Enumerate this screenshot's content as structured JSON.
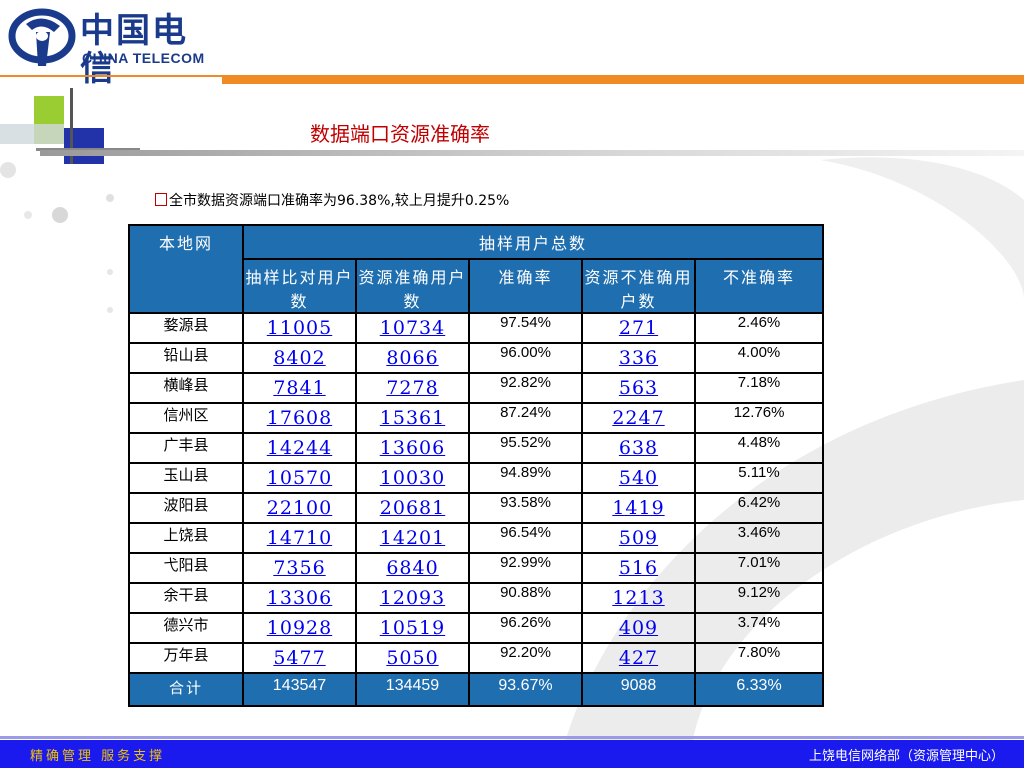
{
  "header": {
    "logo_cn": "中国电信",
    "logo_en": "CHINA TELECOM"
  },
  "title": "数据端口资源准确率",
  "bullet": "全市数据资源端口准确率为96.38%,较上月提升0.25%",
  "table": {
    "col_region": "本地网",
    "col_group": "抽样用户总数",
    "sub_headers": [
      "抽样比对用户数",
      "资源准确用户数",
      "准确率",
      "资源不准确用户数",
      "不准确率"
    ],
    "rows": [
      {
        "name": "婺源县",
        "sample": "11005",
        "accurate": "10734",
        "rate": "97.54%",
        "inaccurate": "271",
        "inrate": "2.46%"
      },
      {
        "name": "铅山县",
        "sample": "8402",
        "accurate": "8066",
        "rate": "96.00%",
        "inaccurate": "336",
        "inrate": "4.00%"
      },
      {
        "name": "横峰县",
        "sample": "7841",
        "accurate": "7278",
        "rate": "92.82%",
        "inaccurate": "563",
        "inrate": "7.18%"
      },
      {
        "name": "信州区",
        "sample": "17608",
        "accurate": "15361",
        "rate": "87.24%",
        "inaccurate": "2247",
        "inrate": "12.76%"
      },
      {
        "name": "广丰县",
        "sample": "14244",
        "accurate": "13606",
        "rate": "95.52%",
        "inaccurate": "638",
        "inrate": "4.48%"
      },
      {
        "name": "玉山县",
        "sample": "10570",
        "accurate": "10030",
        "rate": "94.89%",
        "inaccurate": "540",
        "inrate": "5.11%"
      },
      {
        "name": "波阳县",
        "sample": "22100",
        "accurate": "20681",
        "rate": "93.58%",
        "inaccurate": "1419",
        "inrate": "6.42%"
      },
      {
        "name": "上饶县",
        "sample": "14710",
        "accurate": "14201",
        "rate": "96.54%",
        "inaccurate": "509",
        "inrate": "3.46%"
      },
      {
        "name": "弋阳县",
        "sample": "7356",
        "accurate": "6840",
        "rate": "92.99%",
        "inaccurate": "516",
        "inrate": "7.01%"
      },
      {
        "name": "余干县",
        "sample": "13306",
        "accurate": "12093",
        "rate": "90.88%",
        "inaccurate": "1213",
        "inrate": "9.12%"
      },
      {
        "name": "德兴市",
        "sample": "10928",
        "accurate": "10519",
        "rate": "96.26%",
        "inaccurate": "409",
        "inrate": "3.74%"
      },
      {
        "name": "万年县",
        "sample": "5477",
        "accurate": "5050",
        "rate": "92.20%",
        "inaccurate": "427",
        "inrate": "7.80%"
      }
    ],
    "total": {
      "name": "合计",
      "sample": "143547",
      "accurate": "134459",
      "rate": "93.67%",
      "inaccurate": "9088",
      "inrate": "6.33%"
    }
  },
  "footer": {
    "left": "精确管理 服务支撑",
    "right": "上饶电信网络部（资源管理中心）"
  },
  "colors": {
    "header_blue": "#1f6fb0",
    "title_red": "#c00000",
    "orange_band": "#f08a24",
    "footer_blue": "#1a1aee",
    "footer_slogan": "#f0c000"
  }
}
